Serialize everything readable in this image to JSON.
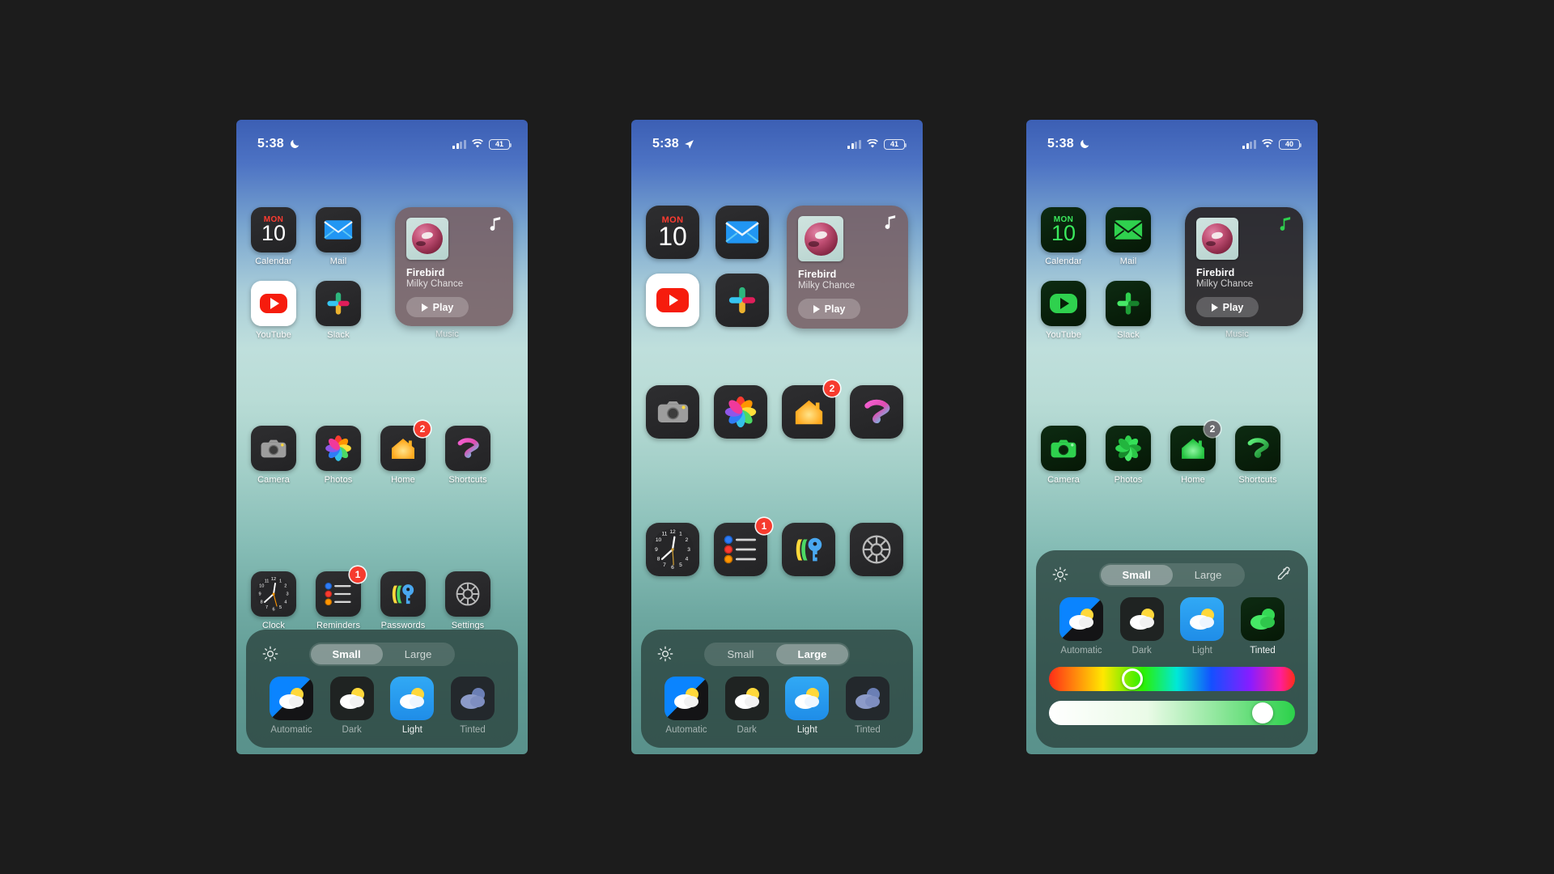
{
  "scene": {
    "background": "#1c1c1c",
    "description": "Three iPhone home screen mockups showing icon appearance customization"
  },
  "phones": [
    {
      "id": "phone-small-light",
      "status": {
        "time": "5:38",
        "left_icon": "crescent-moon-icon",
        "battery_percent": "41",
        "wifi": "wifi-icon",
        "cellular": "cellular-bars-icon"
      },
      "icon_size": "Small",
      "show_labels": true,
      "appearance_mode": "Light",
      "widget": {
        "title": "Firebird",
        "artist": "Milky Chance",
        "play_label": "Play",
        "label": "Music",
        "note_icon": "music-note-icon"
      },
      "rows": [
        [
          {
            "name": "Calendar",
            "weekday": "MON",
            "day": "10",
            "badge": null
          },
          {
            "name": "Mail",
            "badge": null
          }
        ],
        [
          {
            "name": "YouTube",
            "badge": null
          },
          {
            "name": "Slack",
            "badge": null
          }
        ],
        [
          {
            "name": "Camera",
            "badge": null
          },
          {
            "name": "Photos",
            "badge": null
          },
          {
            "name": "Home",
            "badge": "2"
          },
          {
            "name": "Shortcuts",
            "badge": null
          }
        ],
        [
          {
            "name": "Clock",
            "badge": null
          },
          {
            "name": "Reminders",
            "badge": "1"
          },
          {
            "name": "Passwords",
            "badge": null
          },
          {
            "name": "Settings",
            "badge": null
          }
        ]
      ],
      "sheet": {
        "segments": [
          {
            "label": "Small",
            "selected": true
          },
          {
            "label": "Large",
            "selected": false
          }
        ],
        "appearances": [
          {
            "label": "Automatic",
            "selected": false
          },
          {
            "label": "Dark",
            "selected": false
          },
          {
            "label": "Light",
            "selected": true
          },
          {
            "label": "Tinted",
            "selected": false
          }
        ],
        "sun_icon": "brightness-icon",
        "dropper_icon": "eyedropper-icon",
        "show_sliders": false
      }
    },
    {
      "id": "phone-large-light",
      "status": {
        "time": "5:38",
        "left_icon": "location-arrow-icon",
        "battery_percent": "41",
        "wifi": "wifi-icon",
        "cellular": "cellular-bars-icon"
      },
      "icon_size": "Large",
      "show_labels": false,
      "appearance_mode": "Light",
      "widget": {
        "title": "Firebird",
        "artist": "Milky Chance",
        "play_label": "Play",
        "label": "",
        "note_icon": "music-note-icon"
      },
      "rows": [
        [
          {
            "name": "Calendar",
            "weekday": "MON",
            "day": "10",
            "badge": null
          },
          {
            "name": "Mail",
            "badge": null
          }
        ],
        [
          {
            "name": "YouTube",
            "badge": null
          },
          {
            "name": "Slack",
            "badge": null
          }
        ],
        [
          {
            "name": "Camera",
            "badge": null
          },
          {
            "name": "Photos",
            "badge": null
          },
          {
            "name": "Home",
            "badge": "2"
          },
          {
            "name": "Shortcuts",
            "badge": null
          }
        ],
        [
          {
            "name": "Clock",
            "badge": null
          },
          {
            "name": "Reminders",
            "badge": "1"
          },
          {
            "name": "Passwords",
            "badge": null
          },
          {
            "name": "Settings",
            "badge": null
          }
        ]
      ],
      "sheet": {
        "segments": [
          {
            "label": "Small",
            "selected": false
          },
          {
            "label": "Large",
            "selected": true
          }
        ],
        "appearances": [
          {
            "label": "Automatic",
            "selected": false
          },
          {
            "label": "Dark",
            "selected": false
          },
          {
            "label": "Light",
            "selected": true
          },
          {
            "label": "Tinted",
            "selected": false
          }
        ],
        "sun_icon": "brightness-icon",
        "dropper_icon": "eyedropper-icon",
        "show_sliders": false
      }
    },
    {
      "id": "phone-small-tinted",
      "status": {
        "time": "5:38",
        "left_icon": "crescent-moon-icon",
        "battery_percent": "40",
        "wifi": "wifi-icon",
        "cellular": "cellular-bars-icon"
      },
      "icon_size": "Small",
      "show_labels": true,
      "appearance_mode": "Tinted",
      "tint_color": "#2bd14a",
      "widget": {
        "title": "Firebird",
        "artist": "Milky Chance",
        "play_label": "Play",
        "label": "Music",
        "note_icon": "music-note-icon"
      },
      "rows": [
        [
          {
            "name": "Calendar",
            "weekday": "MON",
            "day": "10",
            "badge": null
          },
          {
            "name": "Mail",
            "badge": null
          }
        ],
        [
          {
            "name": "YouTube",
            "badge": null
          },
          {
            "name": "Slack",
            "badge": null
          }
        ],
        [
          {
            "name": "Camera",
            "badge": null
          },
          {
            "name": "Photos",
            "badge": null
          },
          {
            "name": "Home",
            "badge": "2"
          },
          {
            "name": "Shortcuts",
            "badge": null
          }
        ]
      ],
      "sheet": {
        "segments": [
          {
            "label": "Small",
            "selected": true
          },
          {
            "label": "Large",
            "selected": false
          }
        ],
        "appearances": [
          {
            "label": "Automatic",
            "selected": false
          },
          {
            "label": "Dark",
            "selected": false
          },
          {
            "label": "Light",
            "selected": false
          },
          {
            "label": "Tinted",
            "selected": true
          }
        ],
        "sun_icon": "brightness-icon",
        "dropper_icon": "eyedropper-icon",
        "show_sliders": true,
        "hue_slider": {
          "name": "hue-slider",
          "value_percent": 34
        },
        "brightness_slider": {
          "name": "brightness-slider",
          "value_percent": 87
        }
      }
    }
  ]
}
